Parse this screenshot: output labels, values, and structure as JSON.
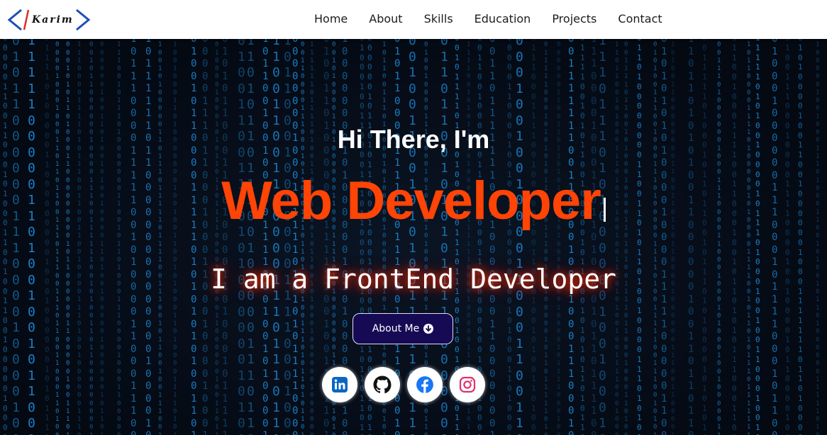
{
  "brand": {
    "logo_text": "Karim",
    "color": "#1e4eb8",
    "accent": "#e22b2b"
  },
  "nav": {
    "items": [
      {
        "label": "Home"
      },
      {
        "label": "About"
      },
      {
        "label": "Skills"
      },
      {
        "label": "Education"
      },
      {
        "label": "Projects"
      },
      {
        "label": "Contact"
      }
    ]
  },
  "hero": {
    "greeting": "Hi There, I'm",
    "role": "Web Developer",
    "tagline": "I am a FrontEnd Developer",
    "button_label": "About Me",
    "button_icon": "arrow-down-circle-icon",
    "role_color": "#ff4406",
    "socials": [
      {
        "name": "linkedin-icon",
        "color": "#0a66c2"
      },
      {
        "name": "github-icon",
        "color": "#111111"
      },
      {
        "name": "facebook-icon",
        "color": "#1877f2"
      },
      {
        "name": "instagram-icon",
        "color": "#e1306c"
      }
    ]
  }
}
